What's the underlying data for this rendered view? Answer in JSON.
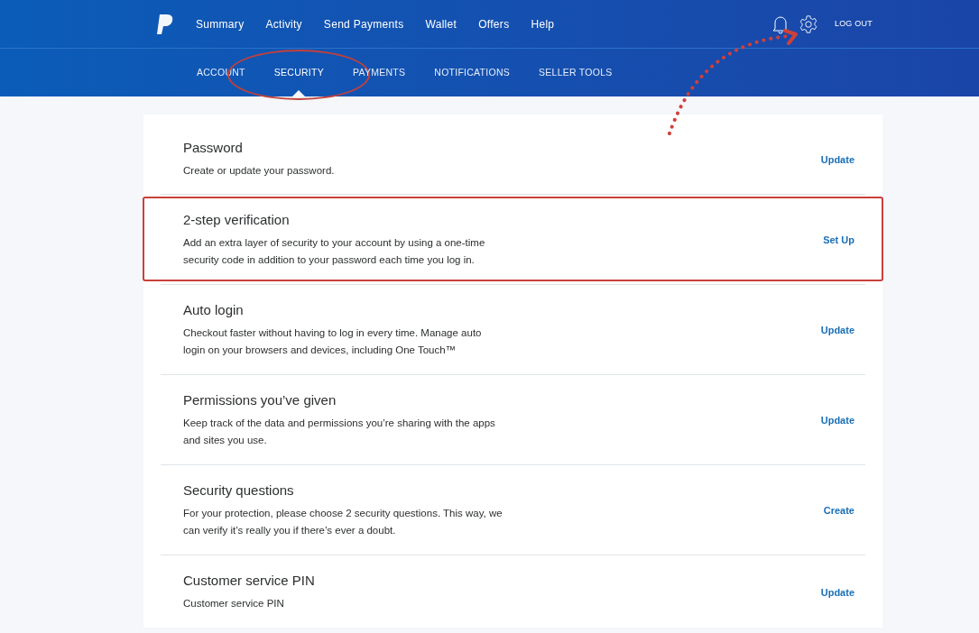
{
  "nav": {
    "items": [
      "Summary",
      "Activity",
      "Send Payments",
      "Wallet",
      "Offers",
      "Help"
    ],
    "logout": "LOG OUT"
  },
  "tabs": [
    {
      "label": "ACCOUNT",
      "selected": false,
      "circled": false
    },
    {
      "label": "SECURITY",
      "selected": true,
      "circled": true
    },
    {
      "label": "PAYMENTS",
      "selected": false,
      "circled": false
    },
    {
      "label": "NOTIFICATIONS",
      "selected": false,
      "circled": false
    },
    {
      "label": "SELLER TOOLS",
      "selected": false,
      "circled": false
    }
  ],
  "settings": [
    {
      "title": "Password",
      "description": "Create or update your password.",
      "action": "Update",
      "highlighted": false
    },
    {
      "title": "2-step verification",
      "description": "Add an extra layer of security to your account by using a one-time security code in addition to your password each time you log in.",
      "action": "Set Up",
      "highlighted": true
    },
    {
      "title": "Auto login",
      "description": "Checkout faster without having to log in every time. Manage auto login on your browsers and devices, including One Touch™",
      "action": "Update",
      "highlighted": false
    },
    {
      "title": "Permissions you’ve given",
      "description": "Keep track of the data and permissions you’re sharing with the apps and sites you use.",
      "action": "Update",
      "highlighted": false
    },
    {
      "title": "Security questions",
      "description": "For your protection, please choose 2 security questions. This way, we can verify it’s really you if there’s ever a doubt.",
      "action": "Create",
      "highlighted": false
    },
    {
      "title": "Customer service PIN",
      "description": "Customer service PIN",
      "action": "Update",
      "highlighted": false
    }
  ]
}
